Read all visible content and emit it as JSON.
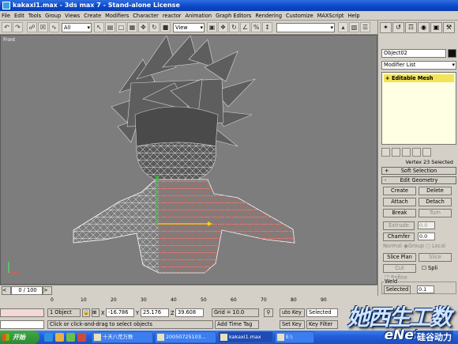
{
  "window": {
    "title": "kakaxi1.max - 3ds max 7 - Stand-alone License"
  },
  "menu": [
    "File",
    "Edit",
    "Tools",
    "Group",
    "Views",
    "Create",
    "Modifiers",
    "Character",
    "reactor",
    "Animation",
    "Graph Editors",
    "Rendering",
    "Customize",
    "MAXScript",
    "Help"
  ],
  "toolbar": {
    "selection_filter": "All",
    "ref_coord": "View",
    "named_selection": "",
    "viewport_right": "View"
  },
  "viewport": {
    "label": "Front"
  },
  "command_panel": {
    "object_name": "Object02",
    "modifier_list": "Modifier List",
    "stack_item": "Editable Mesh",
    "selection_status": "Vertex 23 Selected",
    "soft_selection": "Soft Selection",
    "edit_geometry": "Edit Geometry",
    "buttons": {
      "create": "Create",
      "delete": "Delete",
      "attach": "Attach",
      "detach": "Detach",
      "break": "Break",
      "turn": "Turn",
      "extrude": "Extrude",
      "chamfer": "Chamfer",
      "slice_plane": "Slice Plan",
      "slice": "Slice",
      "cut": "Cut",
      "split": "Spli",
      "refine": "Refine",
      "normal": "Normal",
      "group": "Group",
      "local": "Local"
    },
    "extrude_value": "0.0",
    "chamfer_value": "0.0",
    "weld": {
      "label": "Weld",
      "selected_label": "Selected",
      "selected_value": "0.1"
    }
  },
  "timeline": {
    "frame_counter": "0 / 100",
    "ticks": [
      "0",
      "10",
      "20",
      "30",
      "40",
      "50",
      "60",
      "70",
      "80",
      "90"
    ]
  },
  "status": {
    "selection": "1 Object",
    "x_label": "X",
    "x": "-16.786",
    "y_label": "Y",
    "y": "25.176",
    "z_label": "Z",
    "z": "39.608",
    "grid": "Grid = 10.0",
    "auto_key": "uto Key",
    "set_key": "Set Key",
    "selected_dropdown": "Selected",
    "key_filters": "Key Filter",
    "prompt": "Click or click-and-drag to select objects",
    "add_time_tag": "Add Time Tag"
  },
  "taskbar": {
    "start": "开始",
    "tasks": [
      "十天八荒万秩",
      "20050725103...",
      "kakaxi1.max",
      "E:\\"
    ]
  },
  "watermark": {
    "main": "她西生工数",
    "enet": "eNet",
    "sub": "硅谷动力"
  }
}
